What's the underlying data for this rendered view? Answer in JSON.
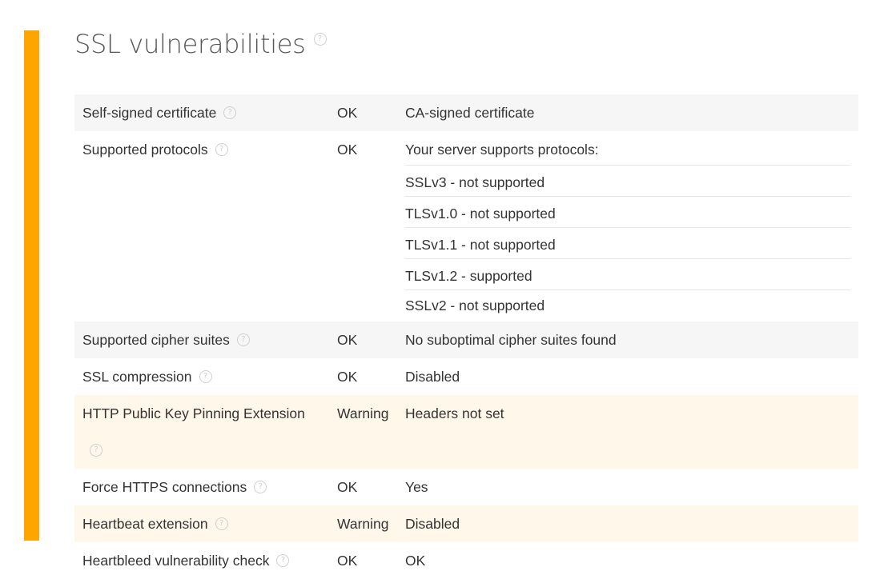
{
  "section": {
    "title": "SSL vulnerabilities",
    "help_icon": "question-circle-icon"
  },
  "colors": {
    "accent": "#ffa500",
    "warning_row": "#fff7ea",
    "shaded_row": "#f6f6f6"
  },
  "rows": [
    {
      "name": "Self-signed certificate",
      "status": "OK",
      "detail": "CA-signed certificate"
    },
    {
      "name": "Supported protocols",
      "status": "OK",
      "detail": "Your server supports protocols:",
      "protocols": [
        "SSLv3 - not supported",
        "TLSv1.0 - not supported",
        "TLSv1.1 - not supported",
        "TLSv1.2 - supported",
        "SSLv2 - not supported"
      ]
    },
    {
      "name": "Supported cipher suites",
      "status": "OK",
      "detail": "No suboptimal cipher suites found"
    },
    {
      "name": "SSL compression",
      "status": "OK",
      "detail": "Disabled"
    },
    {
      "name": "HTTP Public Key Pinning Extension",
      "status": "Warning",
      "detail": "Headers not set"
    },
    {
      "name": "Force HTTPS connections",
      "status": "OK",
      "detail": "Yes"
    },
    {
      "name": "Heartbeat extension",
      "status": "Warning",
      "detail": "Disabled"
    },
    {
      "name": "Heartbleed vulnerability check",
      "status": "OK",
      "detail": "OK"
    }
  ]
}
